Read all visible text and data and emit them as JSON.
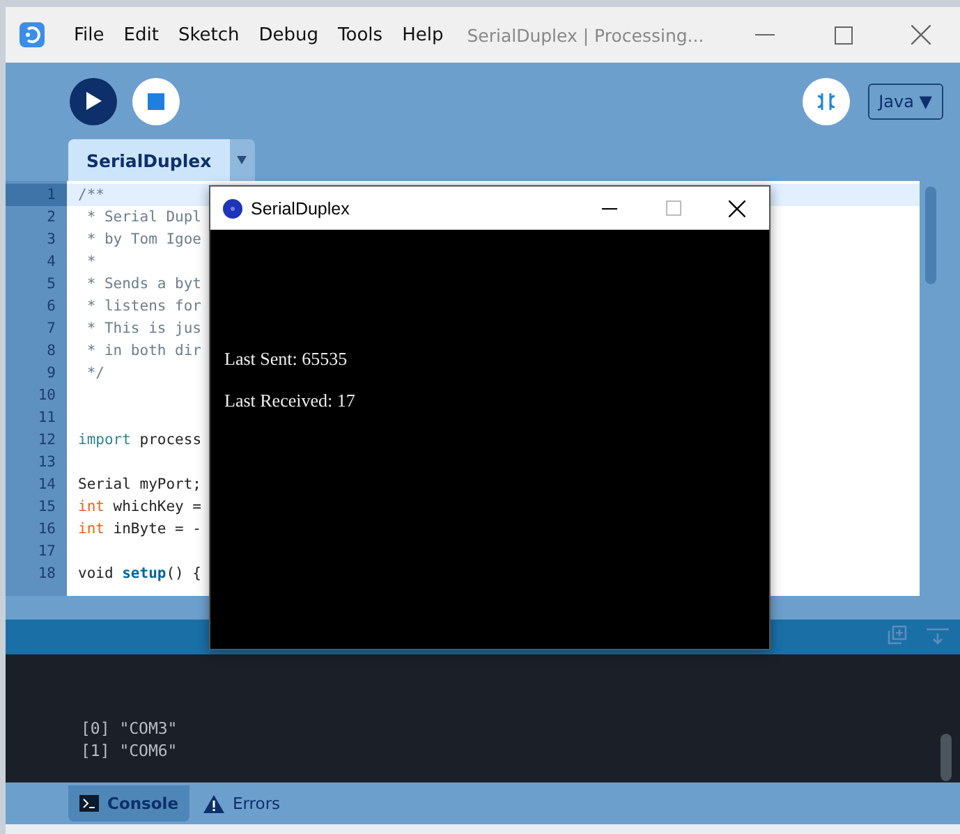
{
  "window": {
    "title": "SerialDuplex | Processing...",
    "menus": [
      "File",
      "Edit",
      "Sketch",
      "Debug",
      "Tools",
      "Help"
    ]
  },
  "toolbar": {
    "mode": "Java ▼"
  },
  "tabs": [
    {
      "label": "SerialDuplex",
      "selected": true
    }
  ],
  "editor": {
    "lines": [
      {
        "number": "1",
        "current": true,
        "segments": [
          {
            "kind": "comment",
            "text": "/**"
          }
        ]
      },
      {
        "number": "2",
        "current": false,
        "segments": [
          {
            "kind": "comment",
            "text": " * Serial Dupl"
          }
        ]
      },
      {
        "number": "3",
        "current": false,
        "segments": [
          {
            "kind": "comment",
            "text": " * by Tom Igoe"
          }
        ]
      },
      {
        "number": "4",
        "current": false,
        "segments": [
          {
            "kind": "comment",
            "text": " *"
          }
        ]
      },
      {
        "number": "5",
        "current": false,
        "segments": [
          {
            "kind": "comment",
            "text": " * Sends a byt"
          }
        ]
      },
      {
        "number": "6",
        "current": false,
        "segments": [
          {
            "kind": "comment",
            "text": " * listens for"
          }
        ]
      },
      {
        "number": "7",
        "current": false,
        "segments": [
          {
            "kind": "comment",
            "text": " * This is jus"
          }
        ]
      },
      {
        "number": "8",
        "current": false,
        "segments": [
          {
            "kind": "comment",
            "text": " * in both dir"
          }
        ]
      },
      {
        "number": "9",
        "current": false,
        "segments": [
          {
            "kind": "comment",
            "text": " */"
          }
        ]
      },
      {
        "number": "10",
        "current": false
      },
      {
        "number": "11",
        "current": false
      },
      {
        "number": "12",
        "current": false,
        "segments": [
          {
            "kind": "keyword",
            "text": "import"
          },
          {
            "kind": "plain",
            "text": " process"
          }
        ]
      },
      {
        "number": "13",
        "current": false
      },
      {
        "number": "14",
        "current": false,
        "segments": [
          {
            "kind": "plain",
            "text": "Serial myPort;"
          }
        ]
      },
      {
        "number": "15",
        "current": false,
        "segments": [
          {
            "kind": "type",
            "text": "int"
          },
          {
            "kind": "plain",
            "text": " whichKey ="
          }
        ]
      },
      {
        "number": "16",
        "current": false,
        "segments": [
          {
            "kind": "type",
            "text": "int"
          },
          {
            "kind": "plain",
            "text": " inByte = -"
          }
        ]
      },
      {
        "number": "17",
        "current": false
      },
      {
        "number": "18",
        "current": false,
        "segments": [
          {
            "kind": "plain",
            "text": "void "
          },
          {
            "kind": "function",
            "text": "setup"
          },
          {
            "kind": "plain",
            "text": "() {"
          }
        ]
      }
    ]
  },
  "console": {
    "lines": [
      "[0] \"COM3\"",
      "[1] \"COM6\""
    ]
  },
  "bottom_tabs": [
    {
      "label": "Console",
      "kind": "console",
      "selected": true
    },
    {
      "label": "Errors",
      "kind": "errors",
      "selected": false
    }
  ],
  "sketch_window": {
    "title": "SerialDuplex",
    "lines": [
      "Last Sent: 65535",
      "Last Received: 17"
    ]
  }
}
